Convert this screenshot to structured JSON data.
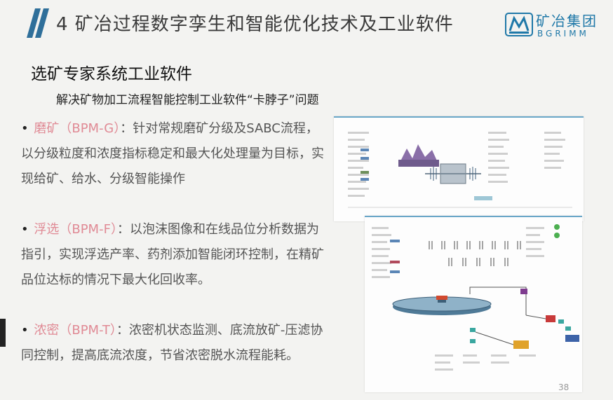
{
  "header": {
    "title": "4 矿冶过程数字孪生和智能优化技术及工业软件",
    "logo_cn": "矿冶集团",
    "logo_en": "BGRIMM"
  },
  "section": {
    "title": "选矿专家系统工业软件",
    "subtitle": "解决矿物加工流程智能控制工业软件“卡脖子”问题"
  },
  "bullets": [
    {
      "marker": "•",
      "keyword": "磨矿（BPM-G）",
      "text": "：针对常规磨矿分级及SABC流程，以分级粒度和浓度指标稳定和最大化处理量为目标，实现给矿、给水、分级智能操作"
    },
    {
      "marker": "•",
      "keyword": "浮选（BPM-F）",
      "text": "：以泡沫图像和在线品位分析数据为指引，实现浮选产率、药剂添加智能闭环控制，在精矿品位达标的情况下最大化回收率。"
    },
    {
      "marker": "•",
      "keyword": "浓密（BPM-T）",
      "text": "：浓密机状态监测、底流放矿-压滤协同控制，提高底流浓度，节省浓密脱水流程能耗。"
    }
  ],
  "page_number": "38",
  "colors": {
    "keyword": "#e08a95",
    "brand": "#1f78a8",
    "accent_stripe": "#2f6f9a"
  }
}
